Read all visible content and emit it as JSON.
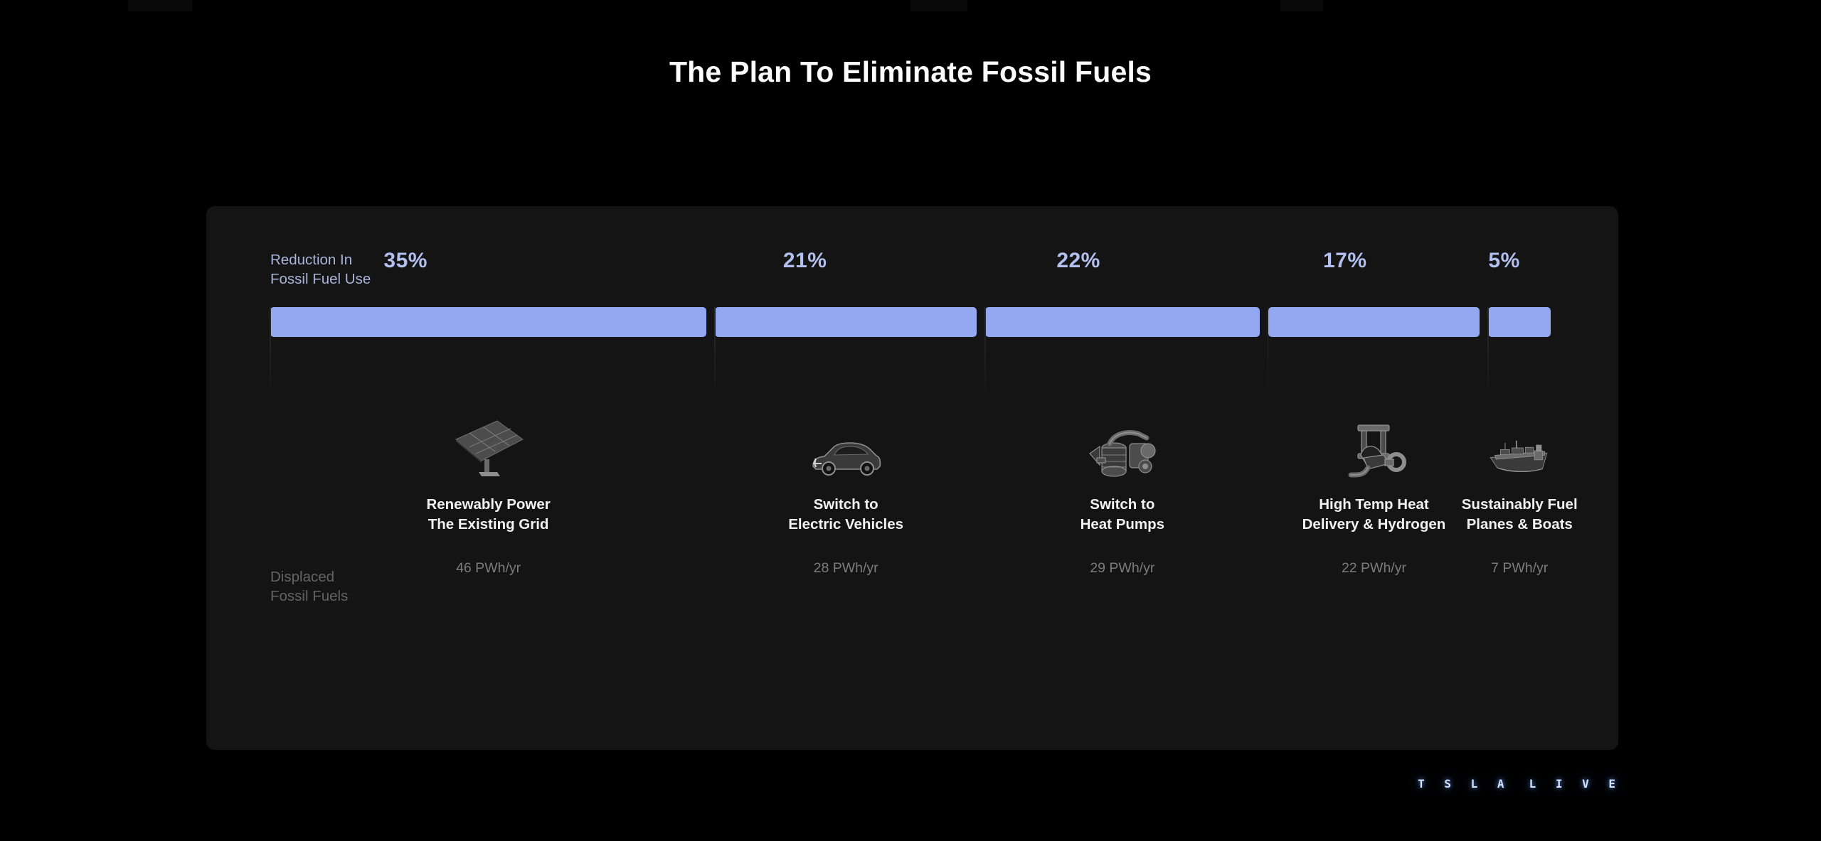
{
  "title": "The Plan To Eliminate Fossil Fuels",
  "axis_labels": {
    "reduction": "Reduction In\nFossil Fuel Use",
    "displaced": "Displaced\nFossil Fuels"
  },
  "branding": {
    "left": "T S L A",
    "right": "L I V E"
  },
  "colors": {
    "bar": "#94a8f2",
    "percent_text": "#b3c0ef",
    "panel_bg": "#141414",
    "page_bg": "#000000",
    "caption_text": "#f2f2f2",
    "muted_text": "#7c7c7c"
  },
  "chart_data": {
    "type": "bar",
    "title": "The Plan To Eliminate Fossil Fuels",
    "xlabel": "",
    "ylabel": "Reduction In Fossil Fuel Use",
    "orientation": "horizontal-segments",
    "categories": [
      "Renewably Power\nThe Existing Grid",
      "Switch to\nElectric Vehicles",
      "Switch to\nHeat Pumps",
      "High Temp Heat\nDelivery & Hydrogen",
      "Sustainably Fuel\nPlanes & Boats"
    ],
    "values": [
      35,
      21,
      22,
      17,
      5
    ],
    "value_labels": [
      "35%",
      "21%",
      "22%",
      "17%",
      "5%"
    ],
    "secondary_label": "Displaced Fossil Fuels",
    "secondary_values": [
      46,
      28,
      29,
      22,
      7
    ],
    "secondary_value_labels": [
      "46 PWh/yr",
      "28 PWh/yr",
      "29 PWh/yr",
      "22 PWh/yr",
      "7 PWh/yr"
    ],
    "unit": "PWh/yr",
    "total_percent": 100,
    "icons": [
      "solar-panel-icon",
      "electric-car-icon",
      "heat-pump-icon",
      "industrial-furnace-icon",
      "cargo-ship-icon"
    ],
    "grid": false,
    "legend": "none"
  }
}
